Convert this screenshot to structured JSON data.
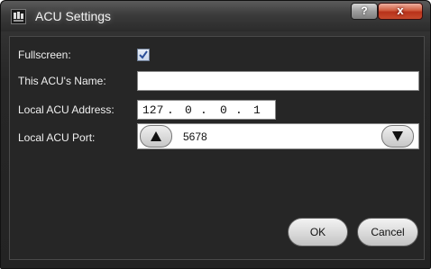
{
  "window": {
    "title": "ACU Settings",
    "help_label": "?",
    "close_label": "x"
  },
  "form": {
    "fullscreen_label": "Fullscreen:",
    "fullscreen_checked": true,
    "name_label": "This ACU's Name:",
    "name_value": "",
    "address_label": "Local ACU Address:",
    "address_segments": [
      "127",
      "0",
      "0",
      "1"
    ],
    "port_label": "Local ACU Port:",
    "port_value": "5678"
  },
  "buttons": {
    "ok_label": "OK",
    "cancel_label": "Cancel"
  },
  "icons": {
    "app": "acu-app-icon",
    "check": "checkmark-icon",
    "up": "triangle-up-icon",
    "down": "triangle-down-icon"
  },
  "colors": {
    "window_bg": "#262626",
    "close_red": "#c64a2d",
    "text": "#f0f0f0"
  }
}
